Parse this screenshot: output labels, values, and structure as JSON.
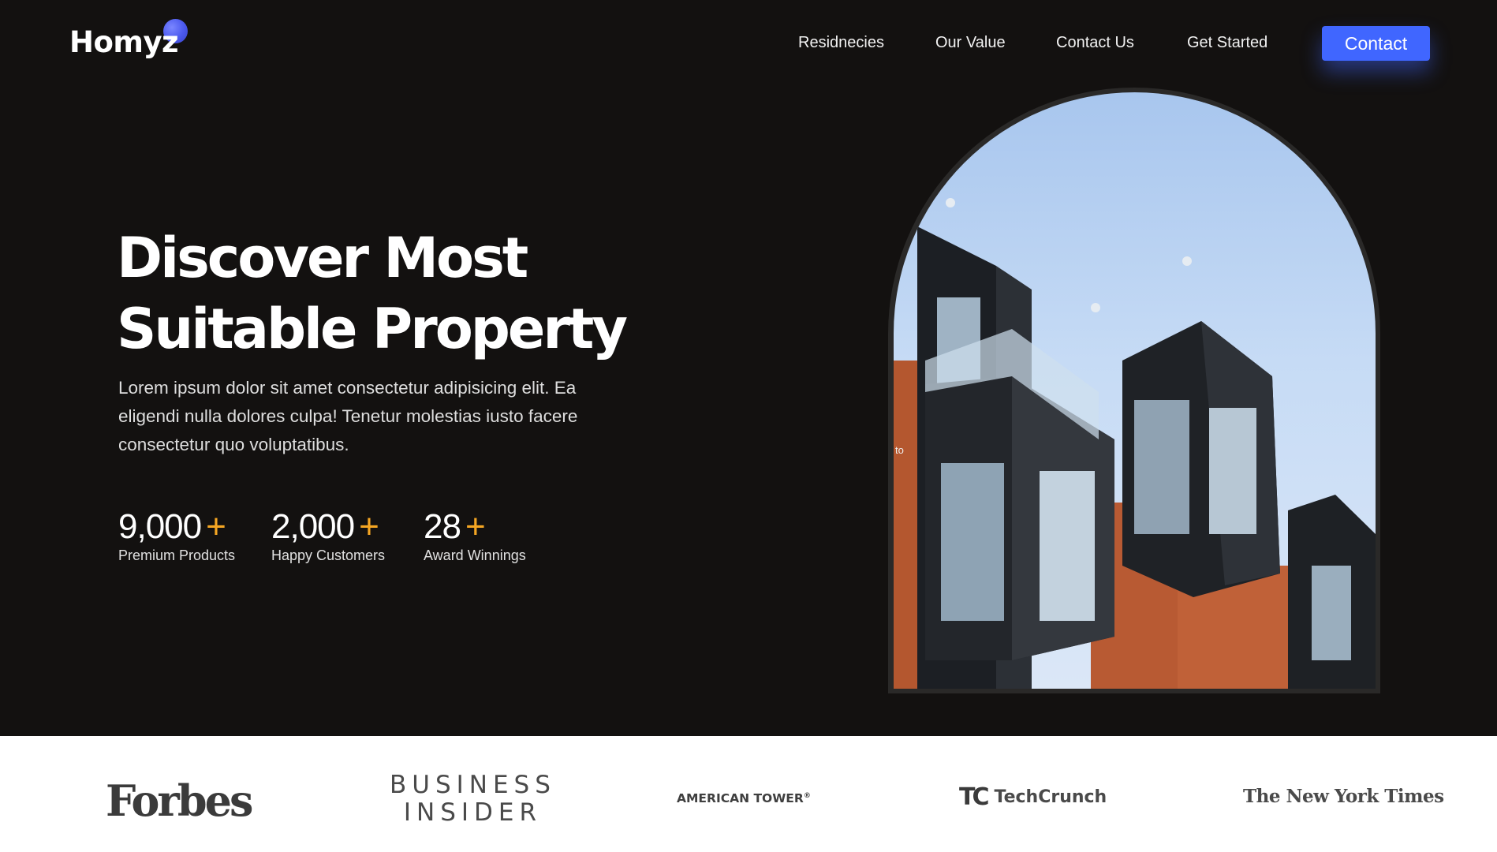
{
  "header": {
    "logo": "Homyz",
    "nav": [
      "Residnecies",
      "Our Value",
      "Contact Us",
      "Get Started"
    ],
    "contact_button": "Contact"
  },
  "hero": {
    "title_line1": "Discover Most",
    "title_line2": "Suitable Property",
    "description": "Lorem ipsum dolor sit amet consectetur adipisicing elit. Ea eligendi nulla dolores culpa! Tenetur molestias iusto facere consectetur quo voluptatibus.",
    "stats": [
      {
        "value": "9,000",
        "plus": "+",
        "label": "Premium Products"
      },
      {
        "value": "2,000",
        "plus": "+",
        "label": "Happy Customers"
      },
      {
        "value": "28",
        "plus": "+",
        "label": "Award Winnings"
      }
    ],
    "image_overlay_text": "to"
  },
  "partners": {
    "forbes": "Forbes",
    "business_insider_line1": "BUSINESS",
    "business_insider_line2": "INSIDER",
    "american_tower": "AMERICAN TOWER",
    "american_tower_mark": "®",
    "techcrunch_mark": "TC",
    "techcrunch": "TechCrunch",
    "nyt": "The New York Times"
  },
  "colors": {
    "background": "#131110",
    "accent_blue": "#4066ff",
    "plus_orange": "#f5a623"
  }
}
